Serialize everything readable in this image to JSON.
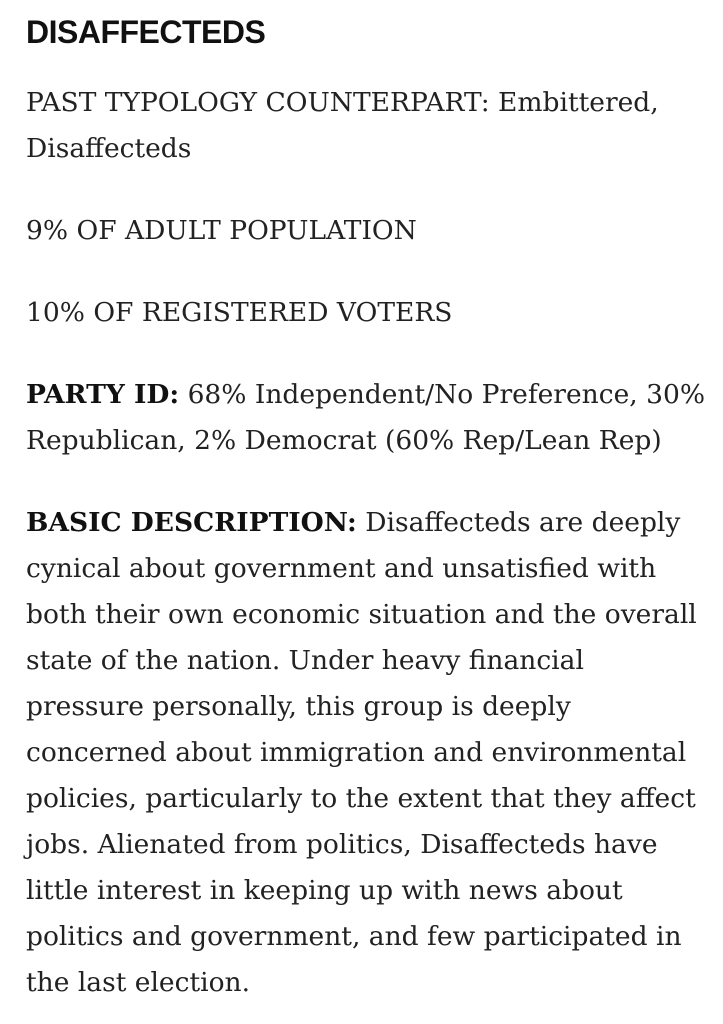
{
  "heading": "DISAFFECTEDS",
  "counterpart": {
    "line1": "PAST TYPOLOGY COUNTERPART: Embittered,",
    "line2": "Disaffecteds"
  },
  "adult_population": "9% OF ADULT POPULATION",
  "registered_voters": "10% OF REGISTERED VOTERS",
  "party_id": {
    "label": "PARTY ID:",
    "line1_text": " 68% Independent/No Preference, 30%",
    "line2": "Republican, 2% Democrat (60% Rep/Lean Rep)"
  },
  "basic_description": {
    "label": "BASIC DESCRIPTION:",
    "line1_text": " Disaffecteds are deeply",
    "lines": [
      "cynical about government and unsatisfied with",
      "both their own economic situation and the overall",
      "state of the nation. Under heavy financial",
      "pressure personally, this group is deeply",
      "concerned about immigration and environmental",
      "policies, particularly to the extent that they affect",
      "jobs. Alienated from politics, Disaffecteds have",
      "little interest in keeping up with news about",
      "politics and government, and few participated in",
      "the last election."
    ]
  }
}
